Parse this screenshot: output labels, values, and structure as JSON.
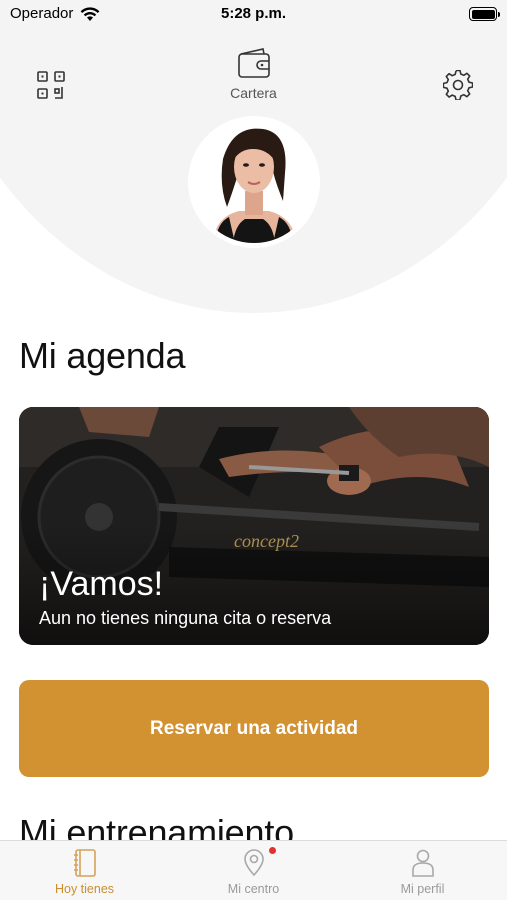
{
  "status_bar": {
    "carrier": "Operador",
    "time": "5:28 p.m.",
    "battery_percent": 100
  },
  "header": {
    "qr_icon": "qr-code-icon",
    "wallet": {
      "icon": "wallet-icon",
      "label": "Cartera"
    },
    "settings_icon": "gear-icon",
    "avatar_icon": "profile-photo"
  },
  "agenda": {
    "title": "Mi agenda",
    "card": {
      "heading": "¡Vamos!",
      "subtitle": "Aun no tienes ninguna cita o reserva",
      "image_brand_text": "concept2"
    },
    "cta_label": "Reservar una actividad"
  },
  "training": {
    "title": "Mi entrenamiento"
  },
  "tab_bar": {
    "items": [
      {
        "label": "Hoy tienes",
        "icon": "notebook-icon",
        "active": true
      },
      {
        "label": "Mi centro",
        "icon": "location-pin-icon",
        "active": false,
        "has_notification": true
      },
      {
        "label": "Mi perfil",
        "icon": "person-icon",
        "active": false
      }
    ]
  },
  "colors": {
    "accent": "#d29231",
    "tab_active": "#c98f2f",
    "header_bg": "#f4f4f4",
    "notification": "#e0322f"
  }
}
